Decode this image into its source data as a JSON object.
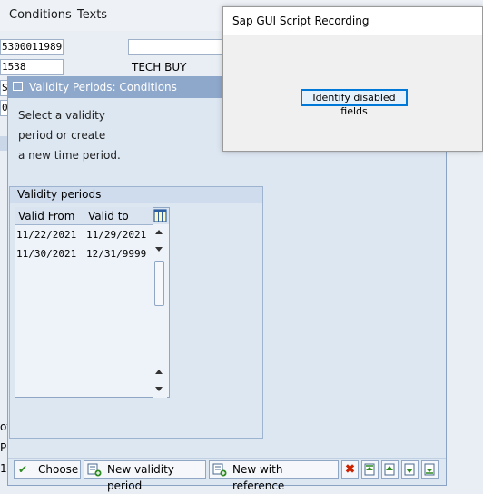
{
  "menu": {
    "items": [
      "Conditions",
      "Texts"
    ]
  },
  "background": {
    "fields": [
      "5300011989",
      "1538",
      "SE",
      "01"
    ],
    "tech_buy_label": "TECH BUY",
    "left_fragments": [
      "of",
      "PC",
      "1"
    ]
  },
  "dialog": {
    "title": "Validity Periods: Conditions",
    "info_lines": [
      "Select a validity",
      "period or create",
      "a new time period."
    ],
    "group_title": "Validity periods",
    "table": {
      "headers": [
        "Valid From",
        "Valid to"
      ],
      "rows": [
        [
          "11/22/2021",
          "11/29/2021"
        ],
        [
          "11/30/2021",
          "12/31/9999"
        ]
      ],
      "column_settings_icon": "table-settings-icon"
    },
    "buttons": {
      "choose": "Choose",
      "new_validity_period": "New validity period",
      "new_with_reference": "New with reference"
    },
    "icon_buttons": [
      "cancel-icon",
      "first-page-icon",
      "previous-page-icon",
      "next-page-icon",
      "last-page-icon"
    ],
    "colors": {
      "title_bar": "#8ea8cc",
      "body": "#dde7f2",
      "cancel": "#cc2200",
      "check": "#2e8b22"
    }
  },
  "recorder": {
    "title": "Sap GUI Script Recording",
    "button": "Identify disabled fields",
    "accent": "#0078d7"
  }
}
